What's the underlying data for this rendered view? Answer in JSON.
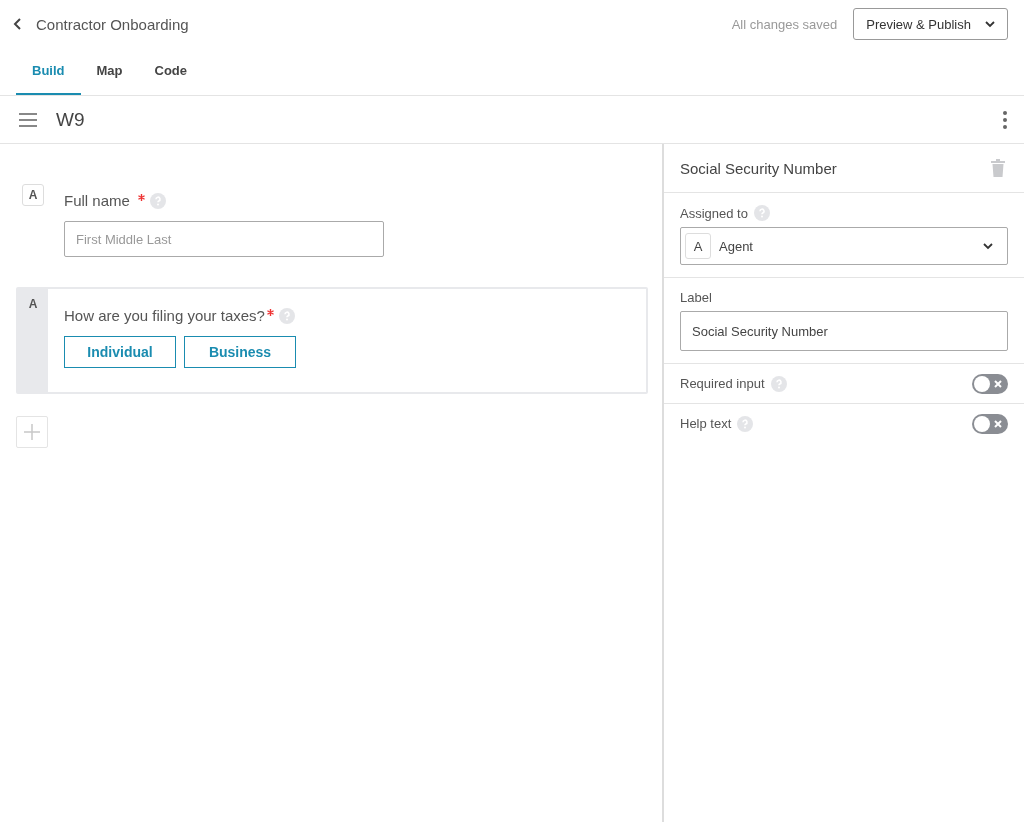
{
  "header": {
    "title": "Contractor Onboarding",
    "save_status": "All changes saved",
    "publish_button": "Preview & Publish"
  },
  "tabs": [
    {
      "label": "Build",
      "selected": true
    },
    {
      "label": "Map",
      "selected": false
    },
    {
      "label": "Code",
      "selected": false
    }
  ],
  "page": {
    "title": "W9"
  },
  "fields": [
    {
      "kind": "text",
      "assignee": "A",
      "label": "Full name",
      "required": true,
      "selected": false,
      "placeholder": "First Middle Last"
    },
    {
      "kind": "choice",
      "assignee": "A",
      "label": "How are you filing your taxes?",
      "required": true,
      "selected": true,
      "options": [
        "Individual",
        "Business"
      ]
    }
  ],
  "inspector": {
    "title": "Social Security Number",
    "assigned_label": "Assigned to",
    "assignee_badge": "A",
    "assignee": "Agent",
    "label_heading": "Label",
    "label_value": "Social Security Number",
    "toggles": [
      {
        "label": "Required input",
        "on": false
      },
      {
        "label": "Help text",
        "on": false
      }
    ]
  }
}
